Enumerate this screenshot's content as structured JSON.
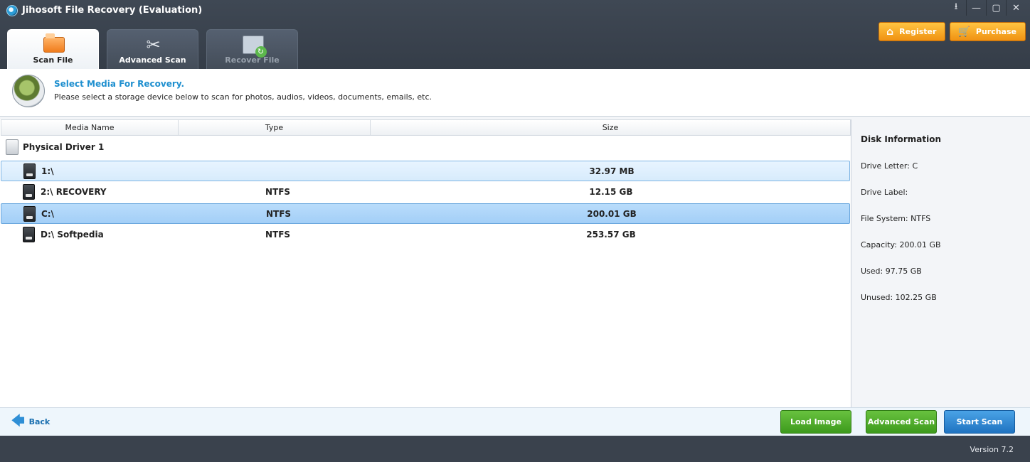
{
  "window": {
    "title": "Jihosoft File Recovery (Evaluation)",
    "controls": [
      "⭳",
      "—",
      "▢",
      "✕"
    ]
  },
  "header_actions": {
    "register": "Register",
    "purchase": "Purchase"
  },
  "tabs": [
    {
      "label": "Scan File",
      "state": "active"
    },
    {
      "label": "Advanced Scan",
      "state": "normal"
    },
    {
      "label": "Recover File",
      "state": "disabled"
    }
  ],
  "banner": {
    "title": "Select Media For Recovery.",
    "subtitle": "Please select a storage device below to scan for photos, audios, videos, documents, emails, etc."
  },
  "table": {
    "columns": [
      "Media Name",
      "Type",
      "Size"
    ],
    "group": "Physical Driver 1",
    "rows": [
      {
        "name": "1:\\",
        "type": "",
        "size": "32.97 MB",
        "state": "hover"
      },
      {
        "name": "2:\\ RECOVERY",
        "type": "NTFS",
        "size": "12.15 GB",
        "state": "normal"
      },
      {
        "name": "C:\\",
        "type": "NTFS",
        "size": "200.01 GB",
        "state": "selected"
      },
      {
        "name": "D:\\ Softpedia",
        "type": "NTFS",
        "size": "253.57 GB",
        "state": "normal"
      }
    ]
  },
  "disk_info": {
    "title": "Disk Information",
    "drive_letter": "Drive Letter: C",
    "drive_label": "Drive Label:",
    "file_system": "File System: NTFS",
    "capacity": "Capacity: 200.01 GB",
    "used": "Used: 97.75 GB",
    "unused": "Unused: 102.25 GB"
  },
  "actions": {
    "back": "Back",
    "load_image": "Load Image",
    "advanced_scan": "Advanced Scan",
    "start_scan": "Start Scan"
  },
  "status": {
    "version": "Version 7.2"
  },
  "colors": {
    "accent_blue": "#1e8fcf",
    "selection": "#a3cff7",
    "orange": "#f09212",
    "green": "#3d9a1c",
    "blue_button": "#1f73c1"
  }
}
